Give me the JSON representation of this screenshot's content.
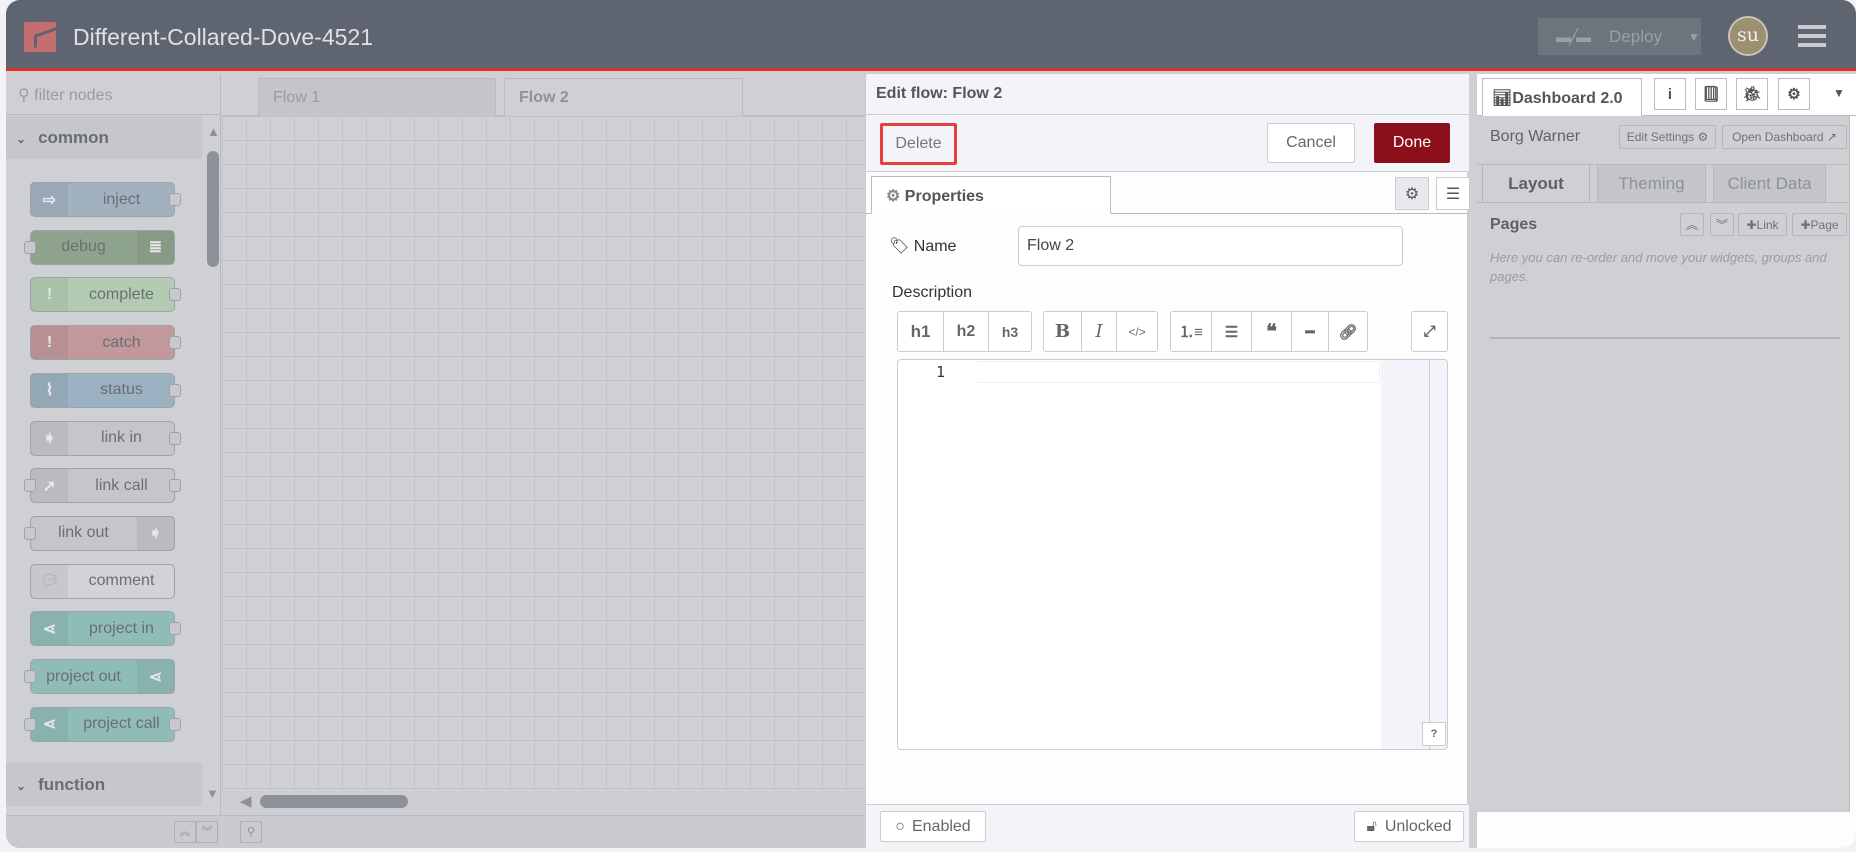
{
  "header": {
    "title": "Different-Collared-Dove-4521",
    "deploy_label": "Deploy",
    "avatar_initials": "su",
    "accent_color": "#d9302c"
  },
  "palette": {
    "filter_placeholder": "filter nodes",
    "categories": [
      {
        "label": "common"
      },
      {
        "label": "function"
      }
    ],
    "nodes": [
      {
        "label": "inject",
        "color": "#a2b1c0",
        "icon": "arrow-right-icon",
        "in": false,
        "out": true,
        "icon_side": "left"
      },
      {
        "label": "debug",
        "color": "#8fa48e",
        "icon": "list-icon",
        "in": true,
        "out": false,
        "icon_side": "right"
      },
      {
        "label": "complete",
        "color": "#b3cbb3",
        "icon": "exclamation-icon",
        "in": false,
        "out": true,
        "icon_side": "left"
      },
      {
        "label": "catch",
        "color": "#c2989b",
        "icon": "exclamation-icon",
        "in": false,
        "out": true,
        "icon_side": "left"
      },
      {
        "label": "status",
        "color": "#9ab2c1",
        "icon": "pulse-icon",
        "in": false,
        "out": true,
        "icon_side": "left"
      },
      {
        "label": "link in",
        "color": "#c5c6ca",
        "icon": "link-in-icon",
        "in": false,
        "out": true,
        "icon_side": "left"
      },
      {
        "label": "link call",
        "color": "#c5c6ca",
        "icon": "link-call-icon",
        "in": true,
        "out": true,
        "icon_side": "left"
      },
      {
        "label": "link out",
        "color": "#c5c6ca",
        "icon": "link-out-icon",
        "in": true,
        "out": false,
        "icon_side": "right"
      },
      {
        "label": "comment",
        "color": "#d2d3d7",
        "icon": "speech-bubble-icon",
        "in": false,
        "out": false,
        "icon_side": "left"
      },
      {
        "label": "project in",
        "color": "#8fbcb7",
        "icon": "project-link-icon",
        "in": false,
        "out": true,
        "icon_side": "left"
      },
      {
        "label": "project out",
        "color": "#8fbcb7",
        "icon": "project-link-icon",
        "in": true,
        "out": false,
        "icon_side": "right"
      },
      {
        "label": "project call",
        "color": "#8fbcb7",
        "icon": "project-link-icon",
        "in": true,
        "out": true,
        "icon_side": "left"
      }
    ]
  },
  "workspace": {
    "tabs": [
      {
        "label": "Flow 1"
      },
      {
        "label": "Flow 2",
        "active": true
      }
    ]
  },
  "tray": {
    "title": "Edit flow: Flow 2",
    "delete_label": "Delete",
    "cancel_label": "Cancel",
    "done_label": "Done",
    "properties_tab": "Properties",
    "name_label": "Name",
    "name_value": "Flow 2",
    "description_label": "Description",
    "toolbar": [
      "h1",
      "h2",
      "h3",
      "B",
      "I",
      "</>"
    ],
    "line_number": "1",
    "help_label": "?",
    "enabled_label": "Enabled",
    "unlocked_label": "Unlocked",
    "done_color": "#8c101c"
  },
  "sidebar": {
    "tab_label": "Dashboard 2.0",
    "dashboard_name": "Borg Warner",
    "edit_settings": "Edit Settings",
    "open_dashboard": "Open Dashboard",
    "tabs": [
      "Layout",
      "Theming",
      "Client Data"
    ],
    "pages_title": "Pages",
    "link_btn": "Link",
    "page_btn": "Page",
    "pages_help": "Here you can re-order and move your widgets, groups and pages."
  }
}
